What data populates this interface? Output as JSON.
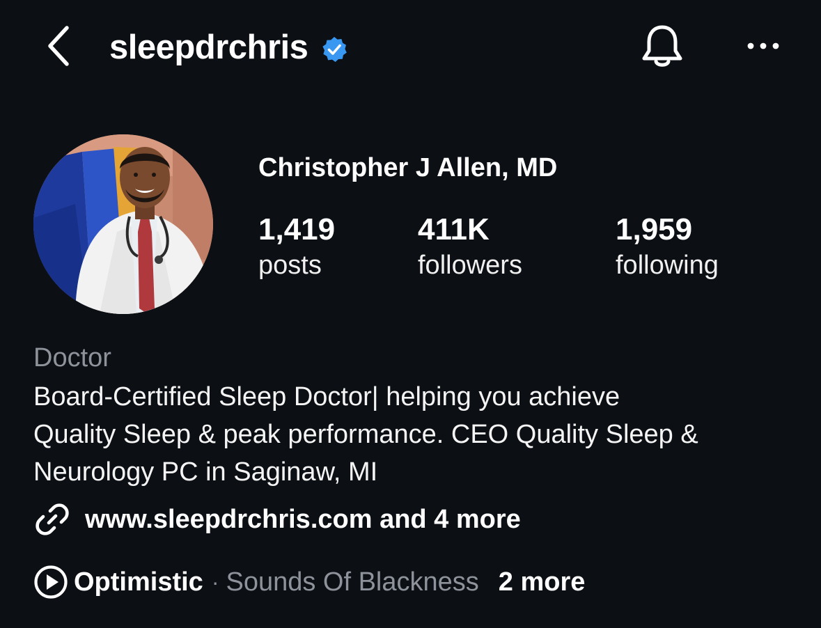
{
  "header": {
    "username": "sleepdrchris",
    "verified": true,
    "icons": {
      "back": "chevron-left-icon",
      "verified": "verified-badge-icon",
      "notifications": "bell-icon",
      "more": "more-horizontal-icon"
    }
  },
  "profile": {
    "display_name": "Christopher J Allen, MD",
    "avatar": "profile-photo",
    "stats": [
      {
        "value": "1,419",
        "label": "posts"
      },
      {
        "value": "411K",
        "label": "followers"
      },
      {
        "value": "1,959",
        "label": "following"
      }
    ]
  },
  "bio": {
    "category": "Doctor",
    "lines": [
      "Board-Certified Sleep Doctor| helping you achieve",
      "Quality Sleep & peak performance. CEO Quality Sleep &",
      "Neurology PC in Saginaw, MI"
    ],
    "link_text": "www.sleepdrchris.com and 4 more",
    "link_icon": "link-icon"
  },
  "music": {
    "icon": "play-circle-icon",
    "title": "Optimistic",
    "separator": "·",
    "artist": "Sounds Of Blackness",
    "more": "2 more"
  },
  "colors": {
    "background": "#0c0f14",
    "text_primary": "#ffffff",
    "text_secondary": "#8e939b",
    "verified_blue": "#3897f0"
  }
}
